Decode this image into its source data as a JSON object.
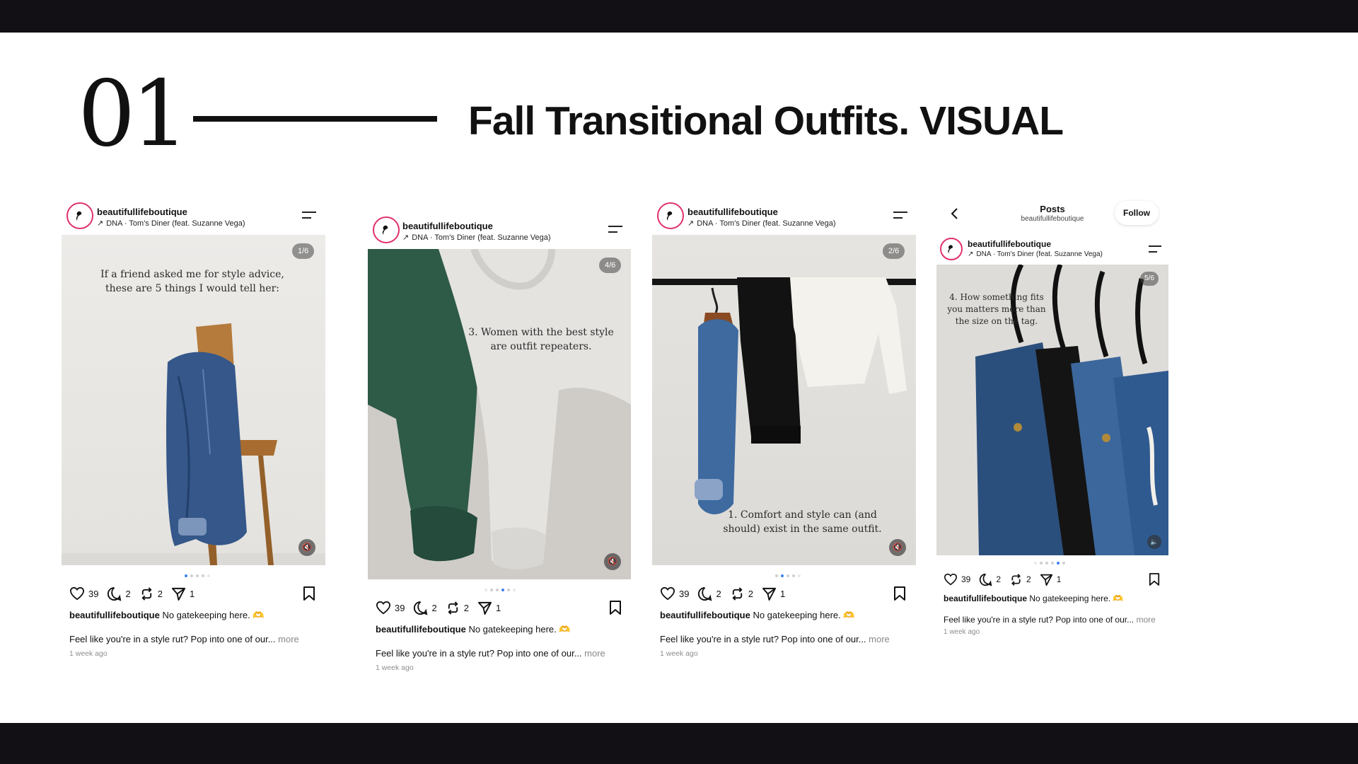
{
  "slide": {
    "number": "01",
    "title": "Fall Transitional Outfits. VISUAL"
  },
  "posts": [
    {
      "username": "beautifullifeboutique",
      "music": "DNA · Tom's Diner (feat. Suzanne Vega)",
      "counter": "1/6",
      "photo_text": "If a friend asked me for style advice, these are 5 things I would tell her:",
      "likes": "39",
      "comments": "2",
      "reposts": "2",
      "shares": "1",
      "caption_user": "beautifullifeboutique",
      "caption_text": "No gatekeeping here. 🫶",
      "description": "Feel like you're in a style rut? Pop into one of our...",
      "more": "more",
      "time": "1 week ago",
      "active_dot": 1,
      "dot_count": 5
    },
    {
      "username": "beautifullifeboutique",
      "music": "DNA · Tom's Diner (feat. Suzanne Vega)",
      "counter": "4/6",
      "photo_text": "3. Women with the best style are outfit repeaters.",
      "likes": "39",
      "comments": "2",
      "reposts": "2",
      "shares": "1",
      "caption_user": "beautifullifeboutique",
      "caption_text": "No gatekeeping here. 🫶",
      "description": "Feel like you're in a style rut? Pop into one of our...",
      "more": "more",
      "time": "1 week ago",
      "active_dot": 4,
      "dot_count": 6
    },
    {
      "username": "beautifullifeboutique",
      "music": "DNA · Tom's Diner (feat. Suzanne Vega)",
      "counter": "2/6",
      "photo_text": "1. Comfort and style can (and should) exist in the same outfit.",
      "likes": "39",
      "comments": "2",
      "reposts": "2",
      "shares": "1",
      "caption_user": "beautifullifeboutique",
      "caption_text": "No gatekeeping here. 🫶",
      "description": "Feel like you're in a style rut? Pop into one of our...",
      "more": "more",
      "time": "1 week ago",
      "active_dot": 2,
      "dot_count": 5
    },
    {
      "posts_title": "Posts",
      "posts_subtitle": "beautifullifeboutique",
      "follow": "Follow",
      "username": "beautifullifeboutique",
      "music": "DNA · Tom's Diner (feat. Suzanne Vega)",
      "counter": "5/6",
      "photo_text": "4. How something fits you matters more than the size on the tag.",
      "likes": "39",
      "comments": "2",
      "reposts": "2",
      "shares": "1",
      "caption_user": "beautifullifeboutique",
      "caption_text": "No gatekeeping here. 🫶",
      "description": "Feel like you're in a style rut? Pop into one of our...",
      "more": "more",
      "time": "1 week ago",
      "active_dot": 5,
      "dot_count": 6
    }
  ],
  "icons": {
    "heart": "heart-icon",
    "comment": "comment-icon",
    "repost": "repost-icon",
    "share": "send-icon",
    "save": "bookmark-icon",
    "mute": "mute-icon",
    "menu": "menu-icon",
    "back": "chevron-left-icon"
  },
  "colors": {
    "frame": "#121015",
    "accent": "#3b82f6",
    "avatar_ring": "#e1306c"
  }
}
